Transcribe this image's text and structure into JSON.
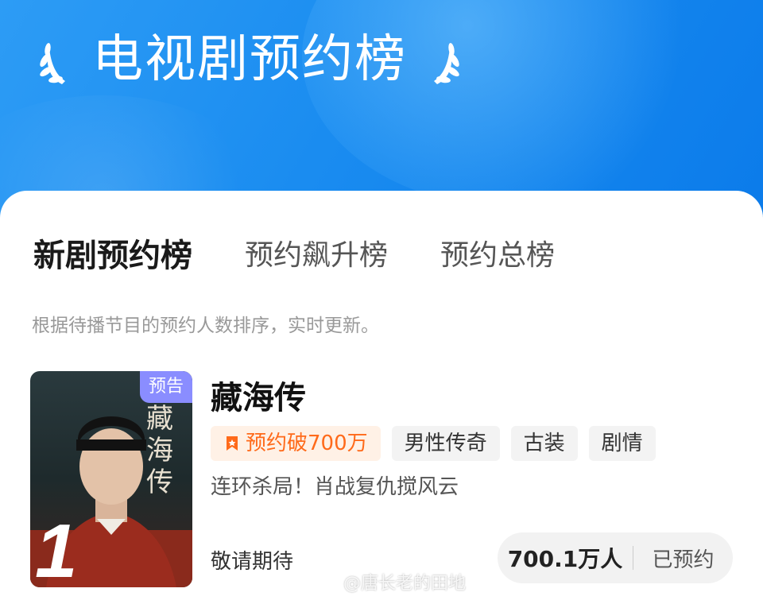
{
  "header": {
    "title": "电视剧预约榜"
  },
  "tabs": [
    {
      "label": "新剧预约榜",
      "active": true
    },
    {
      "label": "预约飙升榜",
      "active": false
    },
    {
      "label": "预约总榜",
      "active": false
    }
  ],
  "subtitle": "根据待播节目的预约人数排序，实时更新。",
  "item": {
    "rank": "1",
    "badge": "预告",
    "poster_title": "藏海传",
    "title": "藏海传",
    "hot_tag": "预约破700万",
    "tags": [
      "男性传奇",
      "古装",
      "剧情"
    ],
    "tagline": "连环杀局！肖战复仇搅风云",
    "status": "敬请期待",
    "reserve_count": "700.1万人",
    "reserve_label": "已预约"
  },
  "watermark": "@唐长老的田地",
  "colors": {
    "accent": "#1a8cf0",
    "hot": "#ff6a1a",
    "badge": "#8a8dff"
  },
  "icons": {
    "laurel": "laurel-icon",
    "hot": "bookmark-icon",
    "watermark": "weibo-icon"
  }
}
